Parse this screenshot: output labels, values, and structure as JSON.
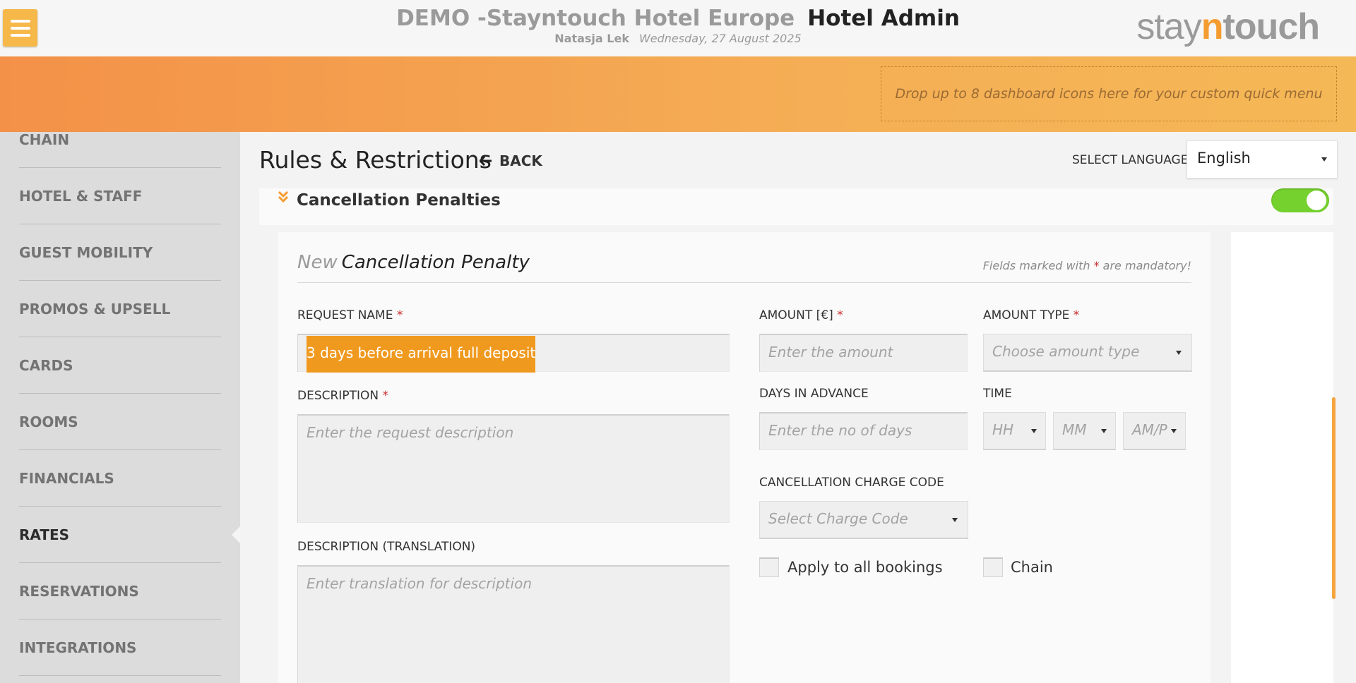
{
  "header": {
    "hotel_name": "DEMO -Stayntouch Hotel Europe",
    "section": "Hotel Admin",
    "user": "Natasja Lek",
    "date": "Wednesday, 27 August 2025",
    "logo": {
      "part1": "stay",
      "part2": "n",
      "part3": "touch"
    }
  },
  "quick_menu": {
    "placeholder": "Drop up to 8 dashboard icons here for your custom quick menu"
  },
  "sidebar": {
    "items": [
      {
        "label": "CHAIN",
        "active": false
      },
      {
        "label": "HOTEL & STAFF",
        "active": false
      },
      {
        "label": "GUEST MOBILITY",
        "active": false
      },
      {
        "label": "PROMOS & UPSELL",
        "active": false
      },
      {
        "label": "CARDS",
        "active": false
      },
      {
        "label": "ROOMS",
        "active": false
      },
      {
        "label": "FINANCIALS",
        "active": false
      },
      {
        "label": "RATES",
        "active": true
      },
      {
        "label": "RESERVATIONS",
        "active": false
      },
      {
        "label": "INTEGRATIONS",
        "active": false
      }
    ]
  },
  "page": {
    "title": "Rules & Restrictions",
    "back_label": "BACK",
    "language_label": "SELECT LANGUAGE",
    "language_value": "English"
  },
  "section": {
    "title": "Cancellation Penalties",
    "toggle_on": true
  },
  "form": {
    "heading_prefix": "New",
    "heading_name": "Cancellation Penalty",
    "mandatory_note_before": "Fields marked with",
    "mandatory_star": "*",
    "mandatory_note_after": "are mandatory!",
    "request_name": {
      "label": "REQUEST NAME",
      "value": "3 days before arrival full deposit"
    },
    "description": {
      "label": "DESCRIPTION",
      "placeholder": "Enter the request description"
    },
    "description_translation": {
      "label": "DESCRIPTION (TRANSLATION)",
      "placeholder": "Enter translation for description"
    },
    "amount": {
      "label": "AMOUNT [€]",
      "placeholder": "Enter the amount"
    },
    "amount_type": {
      "label": "AMOUNT TYPE",
      "placeholder": "Choose amount type"
    },
    "days_in_advance": {
      "label": "DAYS IN ADVANCE",
      "placeholder": "Enter the no of days"
    },
    "time": {
      "label": "TIME",
      "hh": "HH",
      "mm": "MM",
      "ampm": "AM/P"
    },
    "charge_code": {
      "label": "CANCELLATION CHARGE CODE",
      "placeholder": "Select Charge Code"
    },
    "apply_all": {
      "label": "Apply to all bookings",
      "checked": false
    },
    "chain": {
      "label": "Chain",
      "checked": false
    }
  },
  "colors": {
    "accent_orange": "#f59c31",
    "toggle_green": "#74d12e",
    "required_red": "#c92a2a"
  }
}
